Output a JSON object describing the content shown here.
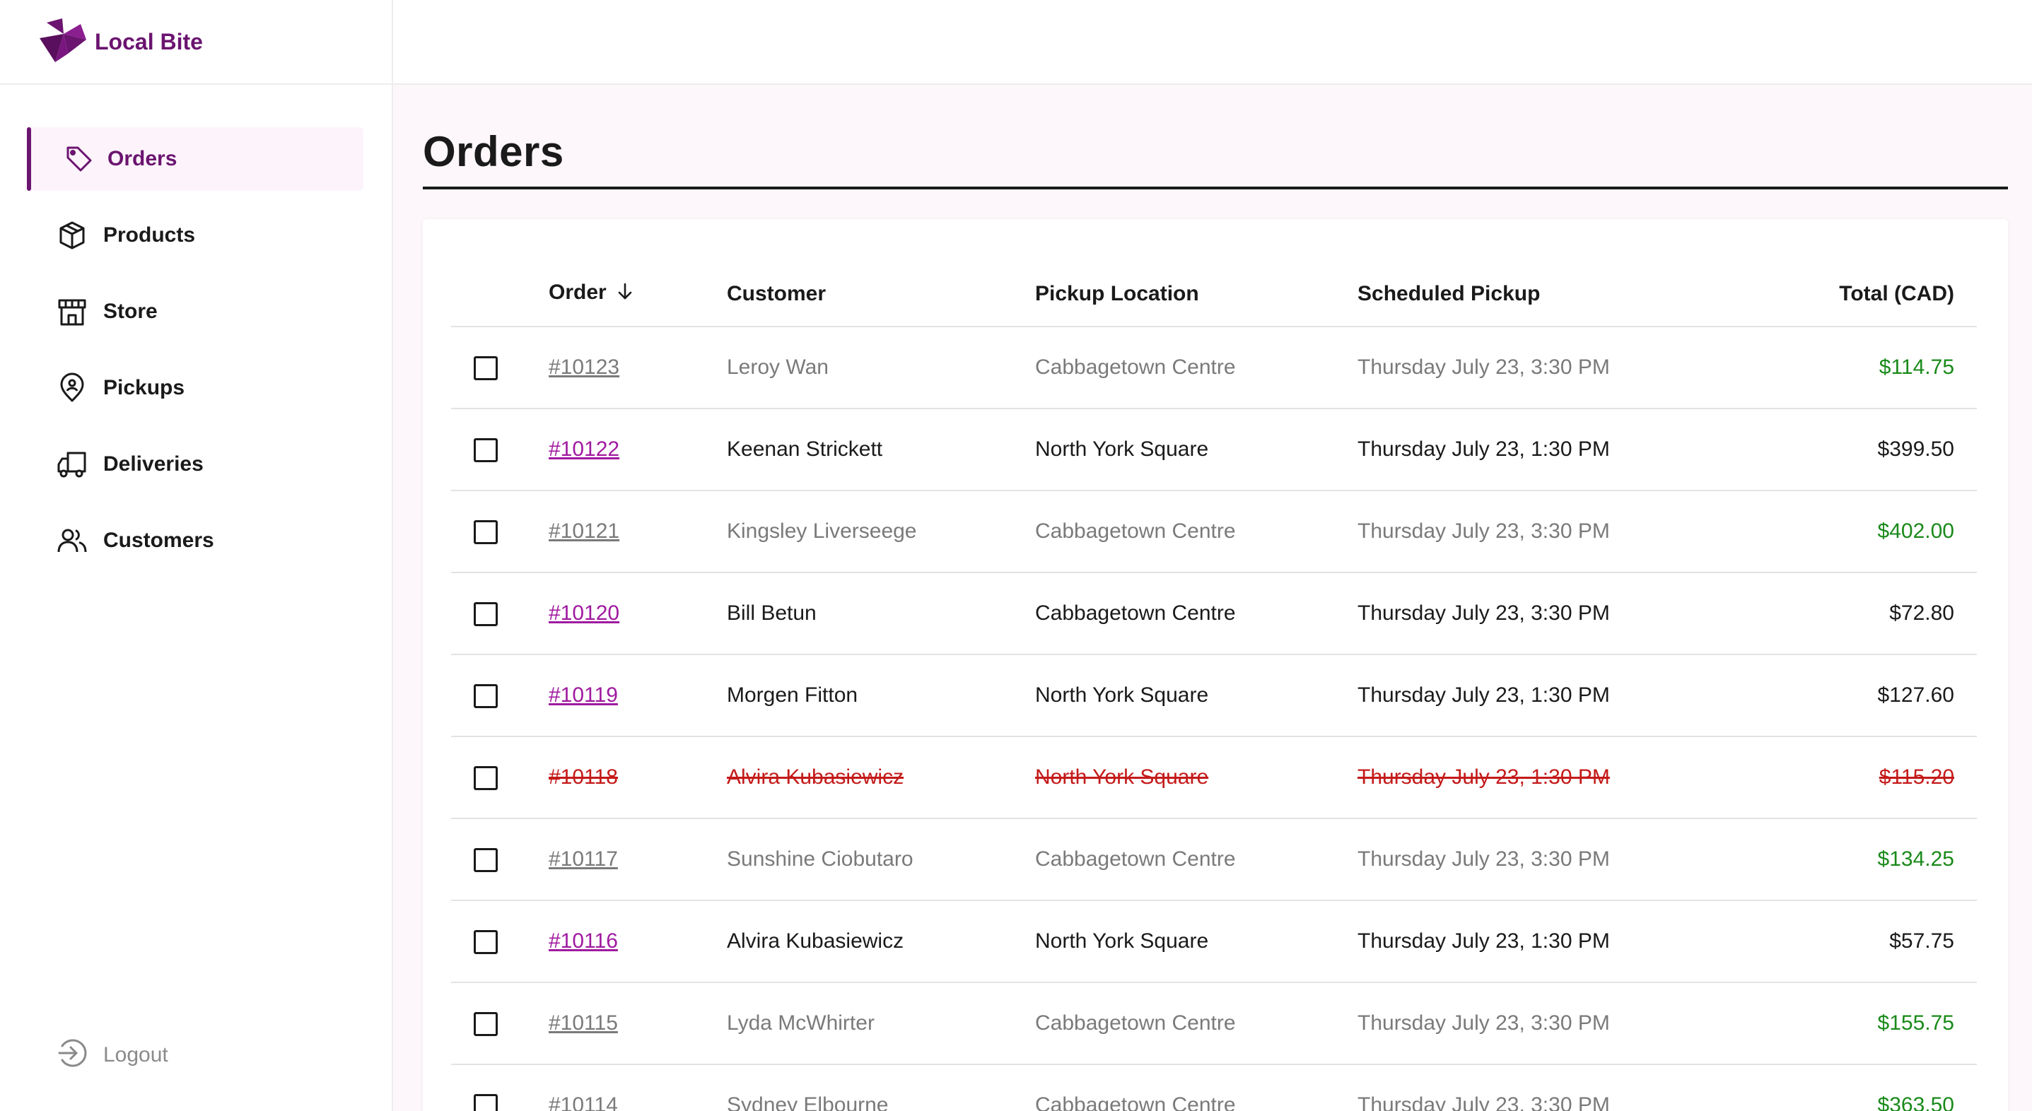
{
  "brand": {
    "name": "Local Bite",
    "color": "#6b1470"
  },
  "sidebar": {
    "items": [
      {
        "label": "Orders",
        "icon": "tag-icon",
        "active": true
      },
      {
        "label": "Products",
        "icon": "box-icon",
        "active": false
      },
      {
        "label": "Store",
        "icon": "storefront-icon",
        "active": false
      },
      {
        "label": "Pickups",
        "icon": "map-pin-icon",
        "active": false
      },
      {
        "label": "Deliveries",
        "icon": "truck-icon",
        "active": false
      },
      {
        "label": "Customers",
        "icon": "users-icon",
        "active": false
      }
    ],
    "logout_label": "Logout"
  },
  "page": {
    "title": "Orders"
  },
  "table": {
    "columns": {
      "order": "Order",
      "customer": "Customer",
      "location": "Pickup Location",
      "scheduled": "Scheduled Pickup",
      "total": "Total (CAD)"
    },
    "sort_icon": "arrow-down-icon",
    "rows": [
      {
        "order": "#10123",
        "customer": "Leroy Wan",
        "location": "Cabbagetown Centre",
        "scheduled": "Thursday July 23, 3:30 PM",
        "total": "$114.75",
        "status": "muted"
      },
      {
        "order": "#10122",
        "customer": "Keenan Strickett",
        "location": "North York Square",
        "scheduled": "Thursday July 23, 1:30 PM",
        "total": "$399.50",
        "status": "normal"
      },
      {
        "order": "#10121",
        "customer": "Kingsley Liverseege",
        "location": "Cabbagetown Centre",
        "scheduled": "Thursday July 23, 3:30 PM",
        "total": "$402.00",
        "status": "muted"
      },
      {
        "order": "#10120",
        "customer": "Bill Betun",
        "location": "Cabbagetown Centre",
        "scheduled": "Thursday July 23, 3:30 PM",
        "total": "$72.80",
        "status": "normal"
      },
      {
        "order": "#10119",
        "customer": "Morgen Fitton",
        "location": "North York Square",
        "scheduled": "Thursday July 23, 1:30 PM",
        "total": "$127.60",
        "status": "normal"
      },
      {
        "order": "#10118",
        "customer": "Alvira Kubasiewicz",
        "location": "North York Square",
        "scheduled": "Thursday July 23, 1:30 PM",
        "total": "$115.20",
        "status": "cancelled"
      },
      {
        "order": "#10117",
        "customer": "Sunshine Ciobutaro",
        "location": "Cabbagetown Centre",
        "scheduled": "Thursday July 23, 3:30 PM",
        "total": "$134.25",
        "status": "muted"
      },
      {
        "order": "#10116",
        "customer": "Alvira Kubasiewicz",
        "location": "North York Square",
        "scheduled": "Thursday July 23, 1:30 PM",
        "total": "$57.75",
        "status": "normal"
      },
      {
        "order": "#10115",
        "customer": "Lyda McWhirter",
        "location": "Cabbagetown Centre",
        "scheduled": "Thursday July 23, 3:30 PM",
        "total": "$155.75",
        "status": "muted"
      },
      {
        "order": "#10114",
        "customer": "Sydney Elbourne",
        "location": "Cabbagetown Centre",
        "scheduled": "Thursday July 23, 3:30 PM",
        "total": "$363.50",
        "status": "muted"
      }
    ]
  },
  "colors": {
    "brand": "#6b1470",
    "link": "#a01aa0",
    "paid_total": "#1a8a1a",
    "cancelled": "#c41a1a",
    "muted_text": "#7a7a7a",
    "main_bg": "#fdf7fb"
  }
}
